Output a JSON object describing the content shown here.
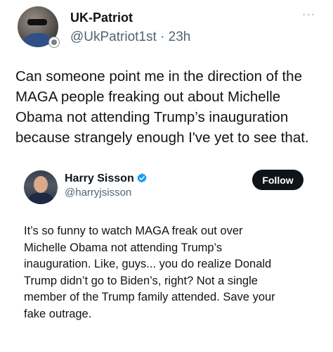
{
  "post": {
    "author": {
      "display_name": "UK-Patriot",
      "handle": "@UkPatriot1st",
      "separator": "·",
      "time": "23h",
      "avatar_icon": "profile-photo"
    },
    "more_icon": "···",
    "text": "Can someone point me in the direction of the\nMAGA people freaking out about Michelle\nObama not attending Trump’s inauguration\nbecause strangely enough I've yet to see that."
  },
  "quoted_post": {
    "author": {
      "display_name": "Harry Sisson",
      "handle": "@harryjsisson",
      "verified_icon": "verified-badge-icon",
      "avatar_icon": "profile-photo"
    },
    "follow_label": "Follow",
    "text": "It’s so funny to watch MAGA freak out over\nMichelle Obama not attending Trump’s\ninauguration. Like, guys... you do realize Donald\nTrump didn’t go to Biden’s, right? Not a single\nmember of the Trump family attended. Save your\nfake outrage."
  },
  "colors": {
    "text": "#0f1419",
    "secondary_text": "#536471",
    "verified_blue": "#1d9bf0",
    "follow_button_bg": "#0f1419"
  }
}
